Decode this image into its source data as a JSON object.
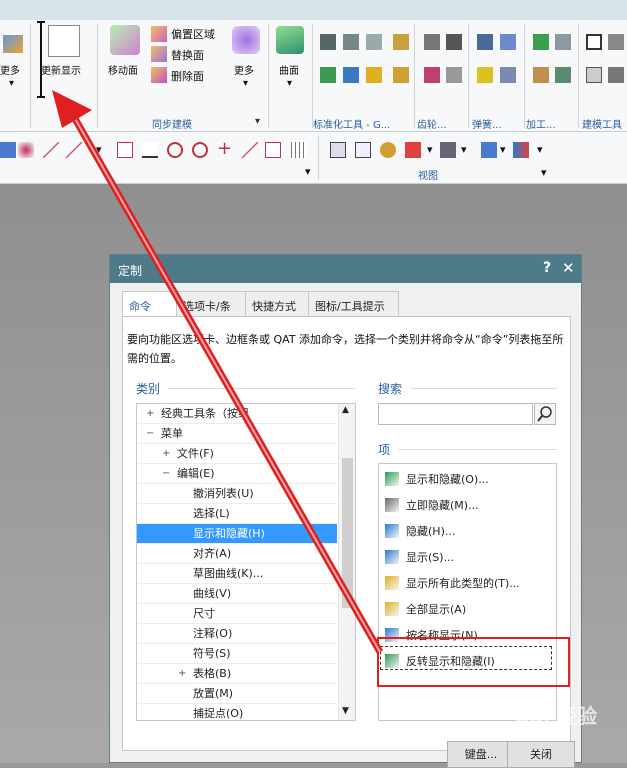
{
  "ribbon": {
    "more_left": "更多",
    "refresh_display": "更新显示",
    "move_face": "移动面",
    "offset_region": "偏置区域",
    "replace_face": "替换面",
    "delete_face": "删除面",
    "more": "更多",
    "surface": "曲面",
    "group_sync": "同步建模",
    "group_std": "标准化工具 - G...",
    "group_gear": "齿轮...",
    "group_spring": "弹簧...",
    "group_machining": "加工...",
    "group_build": "建模工具",
    "group_view": "视图"
  },
  "dialog": {
    "title": "定制",
    "help": "?",
    "close": "✕",
    "tabs": [
      "命令",
      "选项卡/条",
      "快捷方式",
      "图标/工具提示"
    ],
    "description": "要向功能区选项卡、边框条或 QAT 添加命令，选择一个类别并将命令从“命令”列表拖至所需的位置。",
    "category_heading": "类别",
    "search_heading": "搜索",
    "search_value": "",
    "items_heading": "项",
    "categories": [
      {
        "label": "经典工具条（按组",
        "indent": 1,
        "toggle": "+"
      },
      {
        "label": "菜单",
        "indent": 1,
        "toggle": "−"
      },
      {
        "label": "文件(F)",
        "indent": 2,
        "toggle": "+"
      },
      {
        "label": "编辑(E)",
        "indent": 2,
        "toggle": "−"
      },
      {
        "label": "撤消列表(U)",
        "indent": 3,
        "toggle": ""
      },
      {
        "label": "选择(L)",
        "indent": 3,
        "toggle": ""
      },
      {
        "label": "显示和隐藏(H)",
        "indent": 3,
        "toggle": "",
        "selected": true
      },
      {
        "label": "对齐(A)",
        "indent": 3,
        "toggle": ""
      },
      {
        "label": "草图曲线(K)...",
        "indent": 3,
        "toggle": ""
      },
      {
        "label": "曲线(V)",
        "indent": 3,
        "toggle": ""
      },
      {
        "label": "尺寸",
        "indent": 3,
        "toggle": ""
      },
      {
        "label": "注释(O)",
        "indent": 3,
        "toggle": ""
      },
      {
        "label": "符号(S)",
        "indent": 3,
        "toggle": ""
      },
      {
        "label": "表格(B)",
        "indent": 3,
        "toggle": "+"
      },
      {
        "label": "放置(M)",
        "indent": 3,
        "toggle": ""
      },
      {
        "label": "捕捉点(O)",
        "indent": 3,
        "toggle": ""
      }
    ],
    "items": [
      "显示和隐藏(O)...",
      "立即隐藏(M)...",
      "隐藏(H)...",
      "显示(S)...",
      "显示所有此类型的(T)...",
      "全部显示(A)",
      "按名称显示(N)...",
      "反转显示和隐藏(I)"
    ],
    "keyboard_button": "键盘...",
    "close_button": "关闭"
  },
  "watermark": "Bai 经验",
  "colors": {
    "highlight": "#e02020",
    "selection": "#3399ff",
    "title_bar": "#4f7a89"
  }
}
